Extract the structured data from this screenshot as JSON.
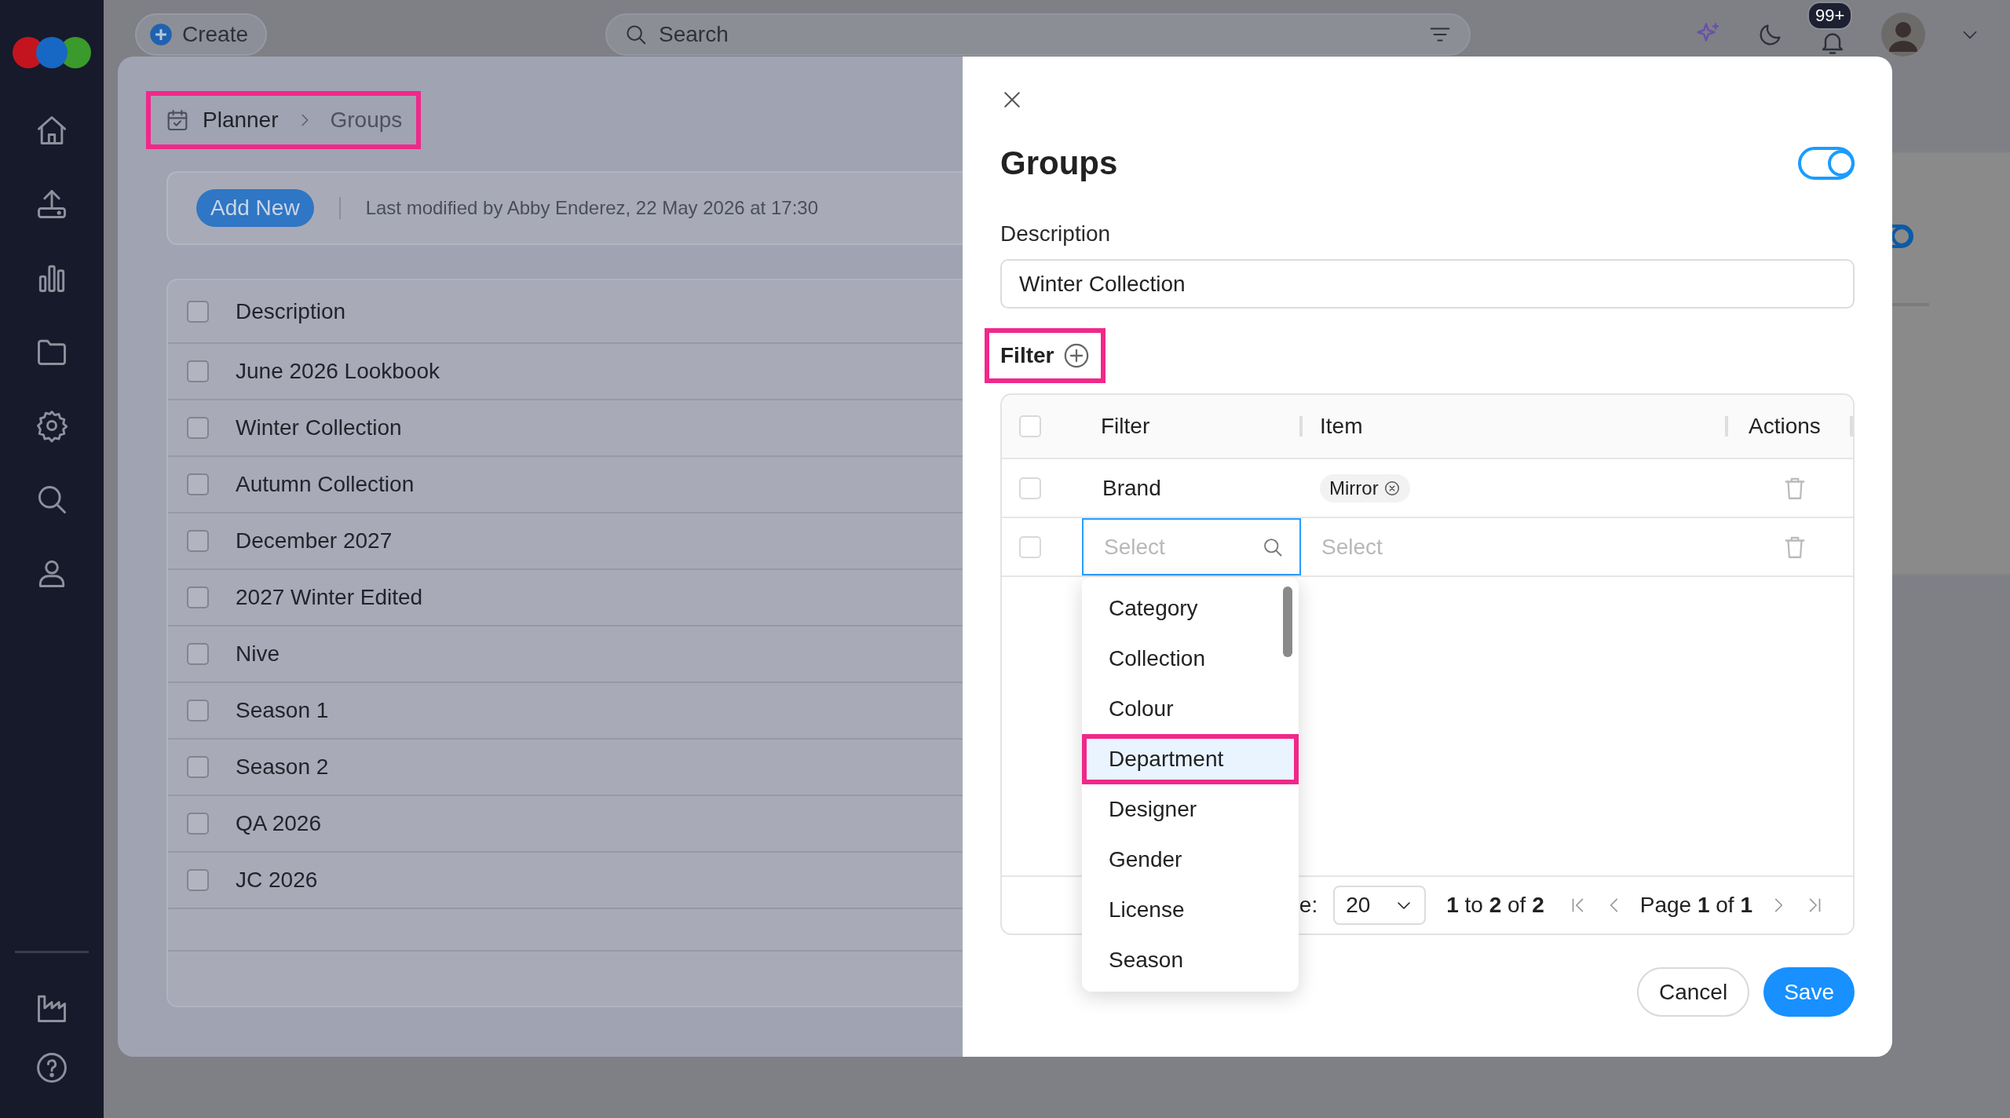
{
  "topbar": {
    "create_button": "Create",
    "search": {
      "placeholder": "Search"
    },
    "notifications_badge": "99+"
  },
  "breadcrumb": {
    "items": [
      "Planner",
      "Groups"
    ],
    "highlighted": true
  },
  "toolbar": {
    "add_button": "Add New",
    "last_modified": "Last modified by Abby Enderez, 22 May 2026 at 17:30"
  },
  "groups_table": {
    "column": "Description",
    "all_checked": false,
    "rows": [
      {
        "description": "June 2026 Lookbook",
        "checked": false
      },
      {
        "description": "Winter Collection",
        "checked": false
      },
      {
        "description": "Autumn Collection",
        "checked": false
      },
      {
        "description": "December 2027",
        "checked": false
      },
      {
        "description": "2027 Winter Edited",
        "checked": false
      },
      {
        "description": "Nive",
        "checked": false
      },
      {
        "description": "Season 1",
        "checked": false
      },
      {
        "description": "Season 2",
        "checked": false
      },
      {
        "description": "QA 2026",
        "checked": false
      },
      {
        "description": "JC 2026",
        "checked": false
      }
    ]
  },
  "drawer": {
    "title": "Groups",
    "enabled": true,
    "description_label": "Description",
    "description_value": "Winter Collection",
    "filter_label": {
      "text": "Filter",
      "highlighted": true
    },
    "filter_table": {
      "columns": [
        "Filter",
        "Item",
        "Actions"
      ],
      "all_checked": false,
      "rows": [
        {
          "kind": "value",
          "checked": false,
          "filter": "Brand",
          "items": [
            "Mirror"
          ]
        },
        {
          "kind": "editing",
          "checked": false,
          "filter_placeholder": "Select",
          "item_placeholder": "Select"
        }
      ],
      "footer": {
        "page_size_label": "e:",
        "page_size": "20",
        "range": "**1** to **2** of **2**",
        "page": "Page **1** of **1**"
      }
    },
    "dropdown": {
      "options": [
        {
          "label": "Category",
          "selected": false,
          "highlighted": false
        },
        {
          "label": "Collection",
          "selected": false,
          "highlighted": false
        },
        {
          "label": "Colour",
          "selected": false,
          "highlighted": false
        },
        {
          "label": "Department",
          "selected": true,
          "highlighted": true
        },
        {
          "label": "Designer",
          "selected": false,
          "highlighted": false
        },
        {
          "label": "Gender",
          "selected": false,
          "highlighted": false
        },
        {
          "label": "License",
          "selected": false,
          "highlighted": false
        },
        {
          "label": "Season",
          "selected": false,
          "highlighted": false
        }
      ]
    },
    "buttons": {
      "cancel": "Cancel",
      "save": "Save"
    }
  }
}
